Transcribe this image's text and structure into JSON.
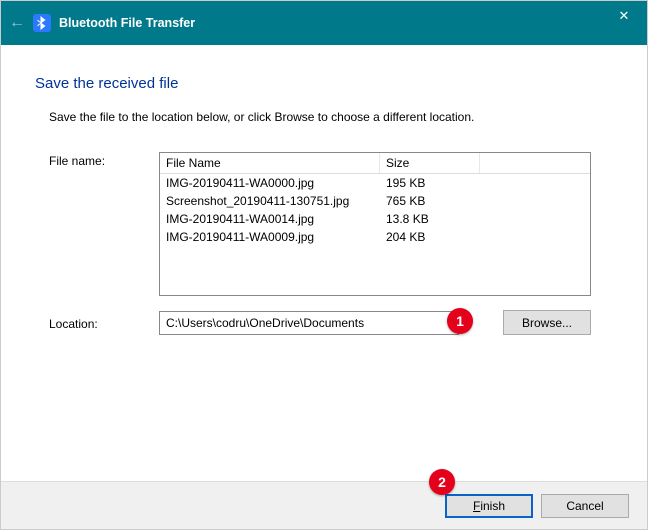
{
  "titlebar": {
    "title": "Bluetooth File Transfer",
    "close_glyph": "✕",
    "back_glyph": "←"
  },
  "page": {
    "heading": "Save the received file",
    "instruction": "Save the file to the location below, or click Browse to choose a different location."
  },
  "labels": {
    "file_name": "File name:",
    "location": "Location:"
  },
  "file_table": {
    "headers": {
      "name": "File Name",
      "size": "Size"
    },
    "rows": [
      {
        "name": "IMG-20190411-WA0000.jpg",
        "size": "195 KB"
      },
      {
        "name": "Screenshot_20190411-130751.jpg",
        "size": "765 KB"
      },
      {
        "name": "IMG-20190411-WA0014.jpg",
        "size": "13.8 KB"
      },
      {
        "name": "IMG-20190411-WA0009.jpg",
        "size": "204 KB"
      }
    ]
  },
  "location": {
    "value": "C:\\Users\\codru\\OneDrive\\Documents",
    "browse_label": "Browse..."
  },
  "footer": {
    "finish_label": "Finish",
    "cancel_label": "Cancel"
  },
  "markers": {
    "one": "1",
    "two": "2"
  }
}
